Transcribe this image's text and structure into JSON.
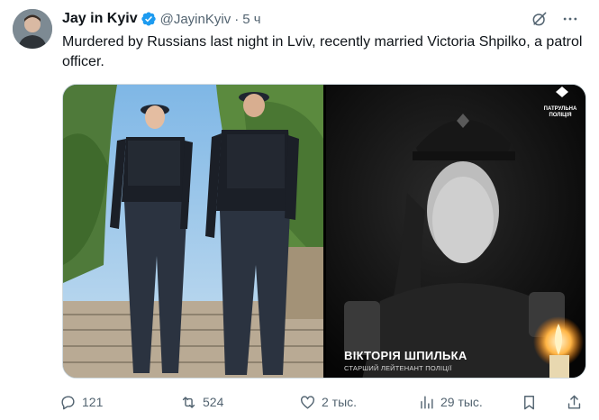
{
  "author": {
    "name": "Jay in Kyiv",
    "handle": "@JayinKyiv",
    "separator": "·",
    "time": "5 ч"
  },
  "tweet": {
    "text": "Murdered by Russians last night in Lviv, recently married Victoria Shpilko, a patrol officer."
  },
  "media": {
    "right_image": {
      "caption_name": "ВІКТОРІЯ ШПИЛЬКА",
      "caption_rank": "СТАРШИЙ ЛЕЙТЕНАНТ ПОЛІЦІЇ",
      "logo_text": "ПАТРУЛЬНА ПОЛІЦІЯ"
    }
  },
  "actions": {
    "replies": "121",
    "retweets": "524",
    "likes": "2 тыс.",
    "views": "29 тыс."
  },
  "colors": {
    "accent": "#1d9bf0",
    "muted": "#536471",
    "text": "#0f1419"
  }
}
